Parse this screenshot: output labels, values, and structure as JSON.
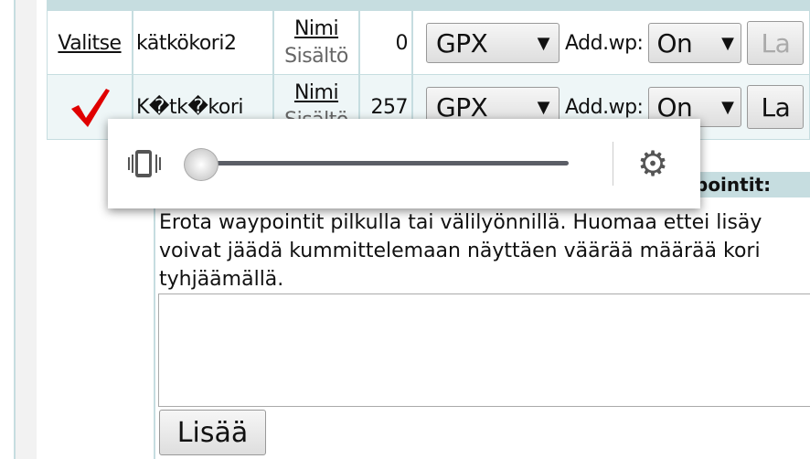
{
  "rows": [
    {
      "select": "Valitse",
      "name": "kätkökori2",
      "link1": "Nimi",
      "link2": "Sisältö",
      "count": "0",
      "format": "GPX",
      "addwp_label": "Add.wp:",
      "addwp": "On",
      "button": "La"
    },
    {
      "select": "",
      "name": "K�tk�kori",
      "link1": "Nimi",
      "link2": "Sisältö",
      "count": "257",
      "format": "GPX",
      "addwp_label": "Add.wp:",
      "addwp": "On",
      "button": "La"
    }
  ],
  "lower": {
    "heading": "pointit:",
    "desc": [
      "Erota waypointit pilkulla tai välilyönnillä. Huomaa ettei lisäy",
      "voivat jäädä kummittelemaan näyttäen väärää määrää kori",
      "tyhjäämällä."
    ],
    "textarea_value": "",
    "add_button": "Lisää"
  },
  "volume_popup": {
    "level": 0,
    "icons": [
      "vibrate-icon",
      "gear-icon"
    ]
  },
  "colors": {
    "accent": "#c6dde0",
    "check": "#e00000"
  }
}
